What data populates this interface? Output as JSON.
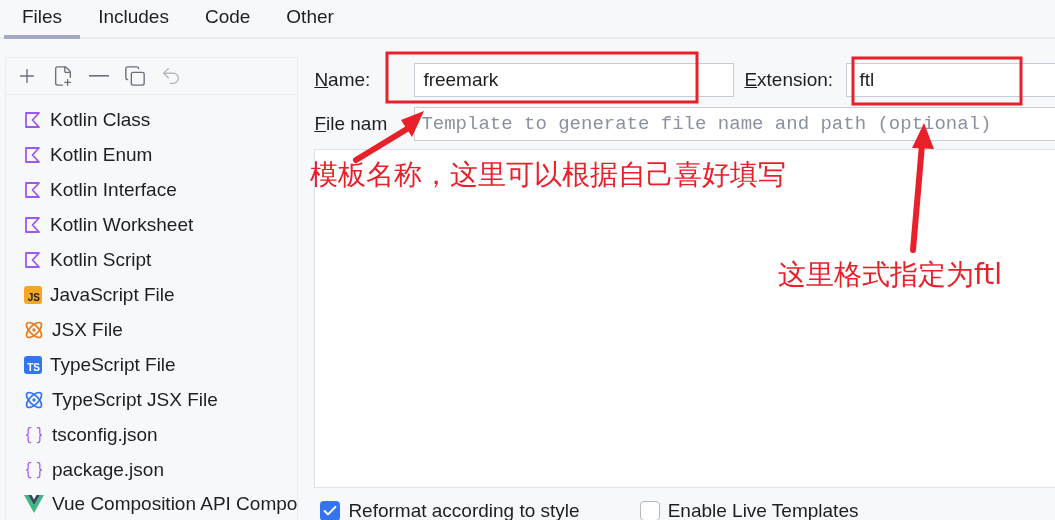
{
  "tabs": [
    {
      "label": "Files",
      "selected": true
    },
    {
      "label": "Includes",
      "selected": false
    },
    {
      "label": "Code",
      "selected": false
    },
    {
      "label": "Other",
      "selected": false
    }
  ],
  "toolbar": [
    {
      "kind": "add",
      "disabled": false
    },
    {
      "kind": "add-file",
      "disabled": false
    },
    {
      "kind": "remove",
      "disabled": false
    },
    {
      "kind": "copy",
      "disabled": false
    },
    {
      "kind": "undo",
      "disabled": true
    }
  ],
  "templates": [
    {
      "kind": "kotlin",
      "label": "Kotlin Class"
    },
    {
      "kind": "kotlin",
      "label": "Kotlin Enum"
    },
    {
      "kind": "kotlin",
      "label": "Kotlin Interface"
    },
    {
      "kind": "kotlin",
      "label": "Kotlin Worksheet"
    },
    {
      "kind": "kotlin",
      "label": "Kotlin Script"
    },
    {
      "kind": "js",
      "badge": "JS",
      "label": "JavaScript File"
    },
    {
      "kind": "jsx",
      "label": "JSX File"
    },
    {
      "kind": "ts",
      "badge": "TS",
      "label": "TypeScript File"
    },
    {
      "kind": "tsx",
      "label": "TypeScript JSX File"
    },
    {
      "kind": "json",
      "label": "tsconfig.json"
    },
    {
      "kind": "json",
      "label": "package.json"
    },
    {
      "kind": "vue",
      "label": "Vue Composition API Compo"
    }
  ],
  "form": {
    "name_label": "Name:",
    "name_value": "freemark",
    "extension_label": "Extension:",
    "extension_value": "ftl",
    "file_name_label": "File nam",
    "file_name_placeholder": "Template to generate file name and path (optional)"
  },
  "options": [
    {
      "label": "Reformat according to style",
      "checked": true
    },
    {
      "label": "Enable Live Templates",
      "checked": false
    }
  ],
  "annotations": [
    {
      "text": "模板名称，这里可以根据自己喜好填写"
    },
    {
      "text": "这里格式指定为ftl"
    }
  ]
}
